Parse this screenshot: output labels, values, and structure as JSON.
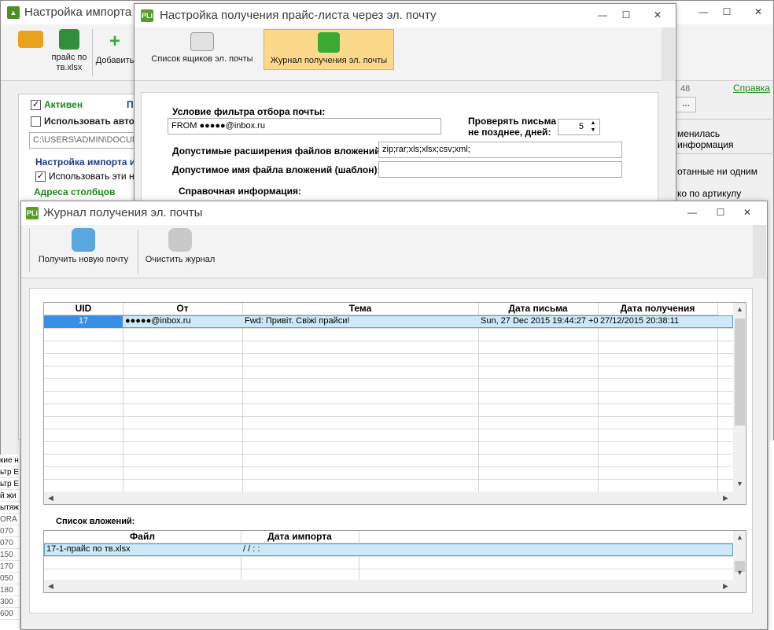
{
  "back_window": {
    "title": "Настройка импорта",
    "toolbar": {
      "file_label": "прайс по тв.xlsx",
      "add_label": "Добавить"
    },
    "active_label": "Активен",
    "partial_label": "П",
    "use_auto_label": "Использовать авто",
    "path_value": "C:\\USERS\\ADMIN\\DOCUME",
    "import_settings_label": "Настройка импорта из",
    "use_these_label": "Использовать эти нас",
    "column_addresses_label": "Адреса столбцов",
    "right_count": "48",
    "help_link": "Справка",
    "dots_btn": "...",
    "info_changed": "менилась информация",
    "not_processed": "отанные ни одним",
    "by_article": "ко по артикулу",
    "left_fragments": [
      "кие н",
      "ьтр Е",
      "ьтр Е",
      "й жи",
      "ытяж",
      "ORA",
      "070",
      "070",
      "150",
      "170",
      "050",
      "180",
      "300",
      "600"
    ]
  },
  "mail_window": {
    "title": "Настройка получения прайс-листа через эл. почту",
    "tabs": [
      {
        "label": "Список ящиков эл. почты",
        "icon": "envelope-icon"
      },
      {
        "label": "Журнал получения эл. почты",
        "icon": "sync-arrows-icon"
      }
    ],
    "filter_label": "Условие фильтра отбора почты:",
    "filter_value": "FROM ●●●●●@inbox.ru",
    "check_days_label_1": "Проверять письма",
    "check_days_label_2": "не позднее, дней:",
    "check_days_value": "5",
    "extensions_label": "Допустимые расширения файлов вложений:",
    "extensions_value": "zip;rar;xls;xlsx;csv;xml;",
    "filename_label": "Допустимое имя файла вложений (шаблон):",
    "filename_value": "",
    "reference_label": "Справочная информация:"
  },
  "journal_window": {
    "title": "Журнал получения эл. почты",
    "toolbar": {
      "get_mail_label": "Получить новую почту",
      "clear_journal_label": "Очистить журнал"
    },
    "grid": {
      "columns": [
        "UID",
        "От",
        "Тема",
        "Дата письма",
        "Дата получения"
      ],
      "rows": [
        {
          "uid": "17",
          "from": "●●●●●@inbox.ru",
          "subject": "Fwd: Привіт. Свіжі прайси!",
          "date_sent": "Sun, 27 Dec 2015 19:44:27 +0",
          "date_received": "27/12/2015 20:38:11"
        }
      ]
    },
    "attachments_label": "Список вложений:",
    "attachments": {
      "columns": [
        "Файл",
        "Дата импорта"
      ],
      "rows": [
        {
          "file": "17-1-прайс по тв.xlsx",
          "import_date": "/ /      : :"
        }
      ]
    }
  }
}
